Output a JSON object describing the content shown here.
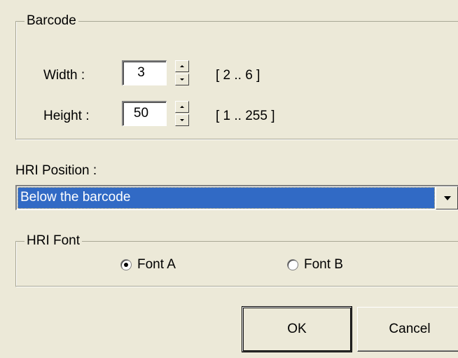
{
  "barcode_group": {
    "title": "Barcode",
    "width": {
      "label": "Width :",
      "value": "3",
      "range": "[ 2 .. 6 ]"
    },
    "height": {
      "label": "Height :",
      "value": "50",
      "range": "[ 1 .. 255 ]"
    }
  },
  "hri_position": {
    "label": "HRI Position :",
    "selected": "Below the barcode"
  },
  "hri_font_group": {
    "title": "HRI Font",
    "options": [
      {
        "label": "Font A",
        "checked": true
      },
      {
        "label": "Font B",
        "checked": false
      }
    ]
  },
  "buttons": {
    "ok": "OK",
    "cancel": "Cancel"
  },
  "colors": {
    "dialog_bg": "#ece9d8",
    "selection": "#316ac5"
  },
  "icons": {
    "spin_up": "spin-up-arrow-icon",
    "spin_down": "spin-down-arrow-icon",
    "dropdown": "dropdown-arrow-icon"
  }
}
